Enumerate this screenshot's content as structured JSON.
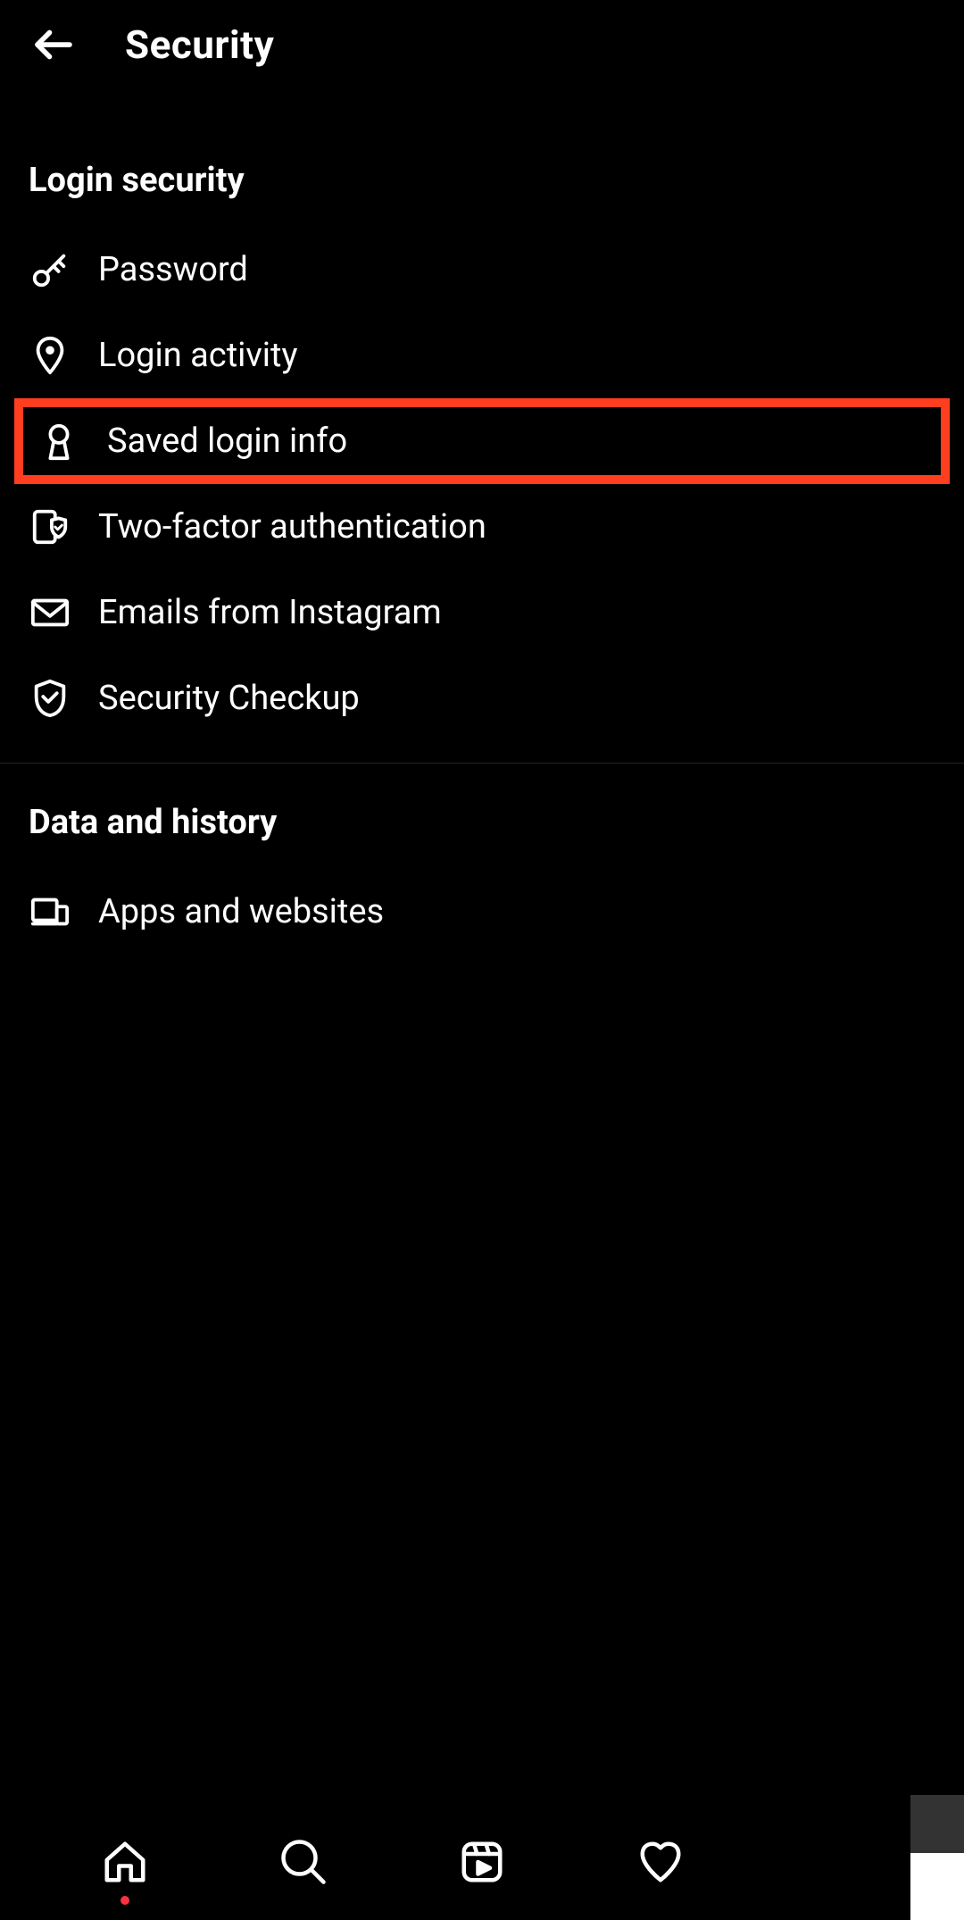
{
  "header": {
    "title": "Security"
  },
  "sections": [
    {
      "title": "Login security",
      "items": [
        {
          "label": "Password"
        },
        {
          "label": "Login activity"
        },
        {
          "label": "Saved login info"
        },
        {
          "label": "Two-factor authentication"
        },
        {
          "label": "Emails from Instagram"
        },
        {
          "label": "Security Checkup"
        }
      ]
    },
    {
      "title": "Data and history",
      "items": [
        {
          "label": "Apps and websites"
        }
      ]
    }
  ]
}
